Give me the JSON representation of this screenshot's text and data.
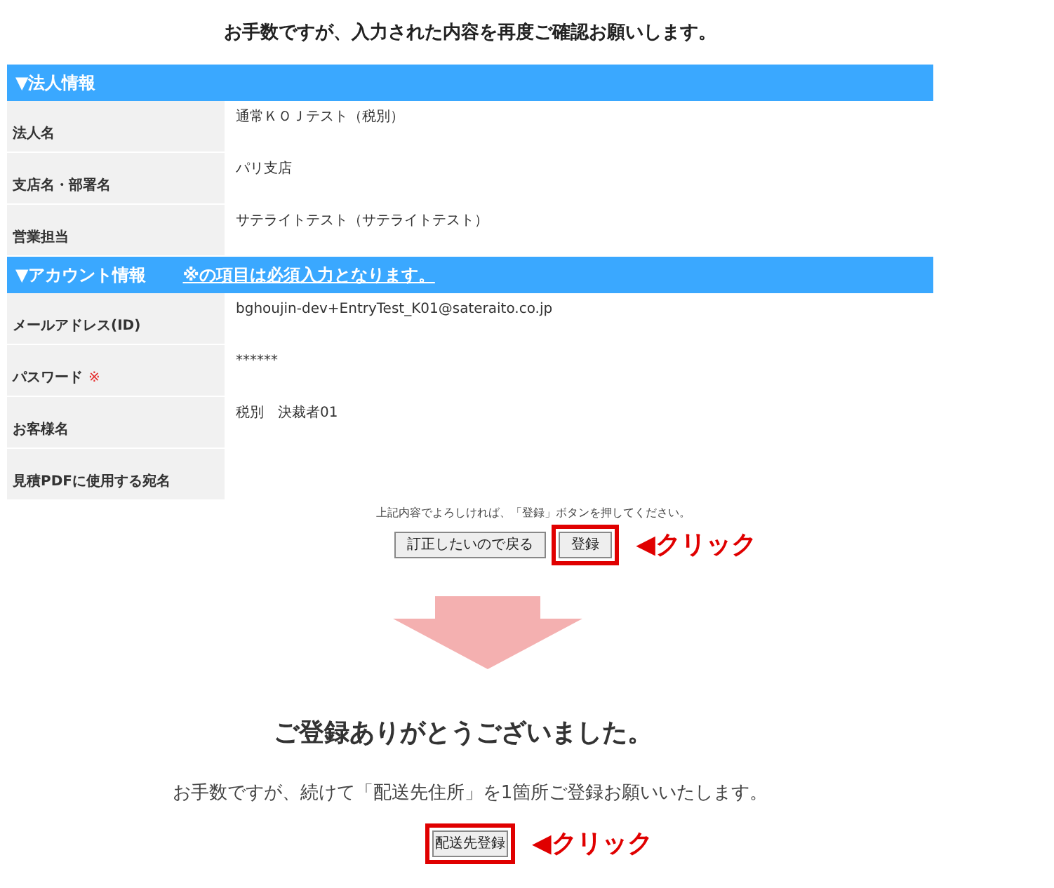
{
  "title": "お手数ですが、入力された内容を再度ご確認お願いします。",
  "sections": [
    {
      "header": "▼法人情報",
      "rows": [
        {
          "label": "法人名",
          "value": "通常ＫＯＪテスト（税別）"
        },
        {
          "label": "支店名・部署名",
          "value": "パリ支店"
        },
        {
          "label": "営業担当",
          "value": "サテライトテスト（サテライトテスト）"
        }
      ]
    },
    {
      "header": "▼アカウント情報",
      "note": "※の項目は必須入力となります。",
      "rows": [
        {
          "label": "メールアドレス(ID)",
          "value": "bghoujin-dev+EntryTest_K01@sateraito.co.jp"
        },
        {
          "label": "パスワード",
          "required_mark": "※",
          "value": "******"
        },
        {
          "label": "お客様名",
          "value": "税別　決裁者01"
        },
        {
          "label": "見積PDFに使用する宛名"
        }
      ]
    }
  ],
  "confirm_hint": "上記内容でよろしければ、「登録」ボタンを押してください。",
  "buttons": [
    {
      "label": "訂正したいので戻る",
      "highlighted": false
    },
    {
      "label": "登録",
      "highlighted": true,
      "callout": "◀クリック"
    }
  ],
  "thanks_title": "ご登録ありがとうございました。",
  "thanks_message": "お手数ですが、続けて「配送先住所」を1箇所ご登録お願いいたします。",
  "next_button": {
    "label": "配送先登録",
    "highlighted": true,
    "callout": "◀クリック"
  }
}
